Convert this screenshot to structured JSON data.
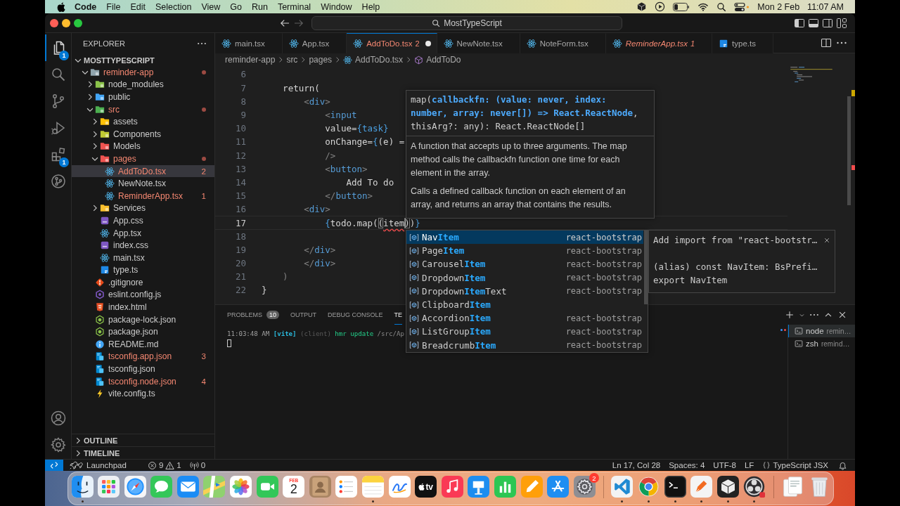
{
  "menu_bar": {
    "app_name": "Code",
    "items": [
      "File",
      "Edit",
      "Selection",
      "View",
      "Go",
      "Run",
      "Terminal",
      "Window",
      "Help"
    ],
    "date": "Mon 2 Feb",
    "time": "11:07 AM"
  },
  "title_bar": {
    "search": "MostTypeScript"
  },
  "activity_bar": {
    "items": [
      {
        "kind": "explorer",
        "selected": true,
        "badge": "1"
      },
      {
        "kind": "search",
        "selected": false
      },
      {
        "kind": "source-control",
        "selected": false
      },
      {
        "kind": "run-debug",
        "selected": false
      },
      {
        "kind": "extensions",
        "selected": false,
        "badge": "1"
      },
      {
        "kind": "remote",
        "selected": false
      }
    ],
    "bottom": [
      {
        "kind": "account"
      },
      {
        "kind": "settings"
      }
    ]
  },
  "sidebar": {
    "title": "EXPLORER",
    "section": "MOSTTYPESCRIPT",
    "tree": [
      {
        "name": "reminder-app",
        "kind": "folder-app",
        "expanded": true,
        "error": true,
        "selected": false,
        "children": [
          {
            "name": "node_modules",
            "kind": "folder-node",
            "expanded": false,
            "error": false,
            "selected": false
          },
          {
            "name": "public",
            "kind": "folder-public",
            "expanded": false,
            "error": false,
            "selected": false
          },
          {
            "name": "src",
            "kind": "folder-src",
            "expanded": true,
            "error": true,
            "selected": false,
            "children": [
              {
                "name": "assets",
                "kind": "folder-assets",
                "expanded": false,
                "error": false,
                "selected": false
              },
              {
                "name": "Components",
                "kind": "folder-components",
                "expanded": false,
                "error": false,
                "selected": false
              },
              {
                "name": "Models",
                "kind": "folder-models",
                "expanded": false,
                "error": false,
                "selected": false
              },
              {
                "name": "pages",
                "kind": "folder-pages",
                "expanded": true,
                "error": true,
                "selected": false,
                "children": [
                  {
                    "name": "AddToDo.tsx",
                    "kind": "react",
                    "error": true,
                    "selected": true,
                    "count": "2"
                  },
                  {
                    "name": "NewNote.tsx",
                    "kind": "react",
                    "error": false,
                    "selected": false
                  },
                  {
                    "name": "ReminderApp.tsx",
                    "kind": "react",
                    "error": true,
                    "selected": false,
                    "count": "1"
                  }
                ]
              },
              {
                "name": "Services",
                "kind": "folder-services",
                "expanded": false,
                "error": false,
                "selected": false
              },
              {
                "name": "App.css",
                "kind": "css",
                "error": false,
                "selected": false
              },
              {
                "name": "App.tsx",
                "kind": "react",
                "error": false,
                "selected": false
              },
              {
                "name": "index.css",
                "kind": "css",
                "error": false,
                "selected": false
              },
              {
                "name": "main.tsx",
                "kind": "react",
                "error": false,
                "selected": false
              },
              {
                "name": "type.ts",
                "kind": "ts",
                "error": false,
                "selected": false
              }
            ]
          },
          {
            "name": ".gitignore",
            "kind": "git",
            "error": false,
            "selected": false
          },
          {
            "name": "eslint.config.js",
            "kind": "eslint",
            "error": false,
            "selected": false
          },
          {
            "name": "index.html",
            "kind": "html",
            "error": false,
            "selected": false
          },
          {
            "name": "package-lock.json",
            "kind": "node-json",
            "error": false,
            "selected": false
          },
          {
            "name": "package.json",
            "kind": "node-json",
            "error": false,
            "selected": false
          },
          {
            "name": "README.md",
            "kind": "info",
            "error": false,
            "selected": false
          },
          {
            "name": "tsconfig.app.json",
            "kind": "tsconfig",
            "error": true,
            "selected": false,
            "count": "3"
          },
          {
            "name": "tsconfig.json",
            "kind": "tsconfig",
            "error": false,
            "selected": false
          },
          {
            "name": "tsconfig.node.json",
            "kind": "tsconfig",
            "error": true,
            "selected": false,
            "count": "4"
          },
          {
            "name": "vite.config.ts",
            "kind": "vite",
            "error": false,
            "selected": false
          }
        ]
      }
    ],
    "collapsed_sections": [
      "OUTLINE",
      "TIMELINE"
    ]
  },
  "tabs": [
    {
      "label": "main.tsx",
      "kind": "react",
      "selected": false,
      "error": false,
      "preview": false,
      "dirty": false
    },
    {
      "label": "App.tsx",
      "kind": "react",
      "selected": false,
      "error": false,
      "preview": false,
      "dirty": false
    },
    {
      "label": "AddToDo.tsx",
      "kind": "react",
      "selected": true,
      "error": true,
      "preview": false,
      "dirty": true,
      "count": "2"
    },
    {
      "label": "NewNote.tsx",
      "kind": "react",
      "selected": false,
      "error": false,
      "preview": false,
      "dirty": false
    },
    {
      "label": "NoteForm.tsx",
      "kind": "react",
      "selected": false,
      "error": false,
      "preview": false,
      "dirty": false
    },
    {
      "label": "ReminderApp.tsx",
      "kind": "react",
      "selected": false,
      "error": true,
      "preview": true,
      "dirty": false,
      "count": "1"
    },
    {
      "label": "type.ts",
      "kind": "ts",
      "selected": false,
      "error": false,
      "preview": false,
      "dirty": false
    }
  ],
  "breadcrumb": [
    {
      "label": "reminder-app",
      "kind": "folder"
    },
    {
      "label": "src",
      "kind": "folder"
    },
    {
      "label": "pages",
      "kind": "folder"
    },
    {
      "label": "AddToDo.tsx",
      "kind": "react"
    },
    {
      "label": "AddToDo",
      "kind": "component"
    }
  ],
  "editor": {
    "lines": [
      {
        "number": "6",
        "current": false
      },
      {
        "number": "7",
        "current": false,
        "tokens": [
          {
            "text": "    return(",
            "kind": "plain"
          }
        ]
      },
      {
        "number": "8",
        "current": false,
        "tokens": [
          {
            "text": "        <",
            "kind": "punct"
          },
          {
            "text": "div",
            "kind": "tag"
          },
          {
            "text": ">",
            "kind": "punct"
          }
        ]
      },
      {
        "number": "9",
        "current": false,
        "tokens": [
          {
            "text": "            <",
            "kind": "punct"
          },
          {
            "text": "input",
            "kind": "tag"
          }
        ]
      },
      {
        "number": "10",
        "current": false,
        "tokens": [
          {
            "text": "            value=",
            "kind": "plain"
          },
          {
            "text": "{task}",
            "kind": "expr"
          }
        ]
      },
      {
        "number": "11",
        "current": false,
        "tokens": [
          {
            "text": "            onChange=",
            "kind": "plain"
          },
          {
            "text": "{",
            "kind": "expr"
          },
          {
            "text": "(e) =",
            "kind": "plain"
          }
        ]
      },
      {
        "number": "12",
        "current": false,
        "tokens": [
          {
            "text": "            />",
            "kind": "punct"
          }
        ]
      },
      {
        "number": "13",
        "current": false,
        "tokens": [
          {
            "text": "            <",
            "kind": "punct"
          },
          {
            "text": "button",
            "kind": "tag"
          },
          {
            "text": ">",
            "kind": "punct"
          }
        ]
      },
      {
        "number": "14",
        "current": false,
        "tokens": [
          {
            "text": "                Add To do",
            "kind": "plain"
          }
        ]
      },
      {
        "number": "15",
        "current": false,
        "tokens": [
          {
            "text": "            </",
            "kind": "punct"
          },
          {
            "text": "button",
            "kind": "tag"
          },
          {
            "text": ">",
            "kind": "punct"
          }
        ]
      },
      {
        "number": "16",
        "current": false,
        "tokens": [
          {
            "text": "        <",
            "kind": "punct"
          },
          {
            "text": "div",
            "kind": "tag"
          },
          {
            "text": ">",
            "kind": "punct"
          }
        ]
      },
      {
        "number": "17",
        "current": true,
        "tokens": [
          {
            "text": "            {",
            "kind": "expr"
          },
          {
            "text": "todo.map(",
            "kind": "plain"
          },
          {
            "text": "(",
            "kind": "bracket"
          },
          {
            "text": "item",
            "kind": "error"
          },
          {
            "text": ")",
            "kind": "bracket-caret"
          },
          {
            "text": ")",
            "kind": "plain"
          },
          {
            "text": "}",
            "kind": "expr"
          }
        ]
      },
      {
        "number": "18",
        "current": false
      },
      {
        "number": "19",
        "current": false,
        "tokens": [
          {
            "text": "        </",
            "kind": "punct"
          },
          {
            "text": "div",
            "kind": "tag"
          },
          {
            "text": ">",
            "kind": "punct"
          }
        ]
      },
      {
        "number": "20",
        "current": false,
        "tokens": [
          {
            "text": "        </",
            "kind": "punct"
          },
          {
            "text": "div",
            "kind": "tag"
          },
          {
            "text": ">",
            "kind": "punct"
          }
        ]
      },
      {
        "number": "21",
        "current": false,
        "tokens": [
          {
            "text": "    )",
            "kind": "punct"
          }
        ]
      },
      {
        "number": "22",
        "current": false,
        "tokens": [
          {
            "text": "}",
            "kind": "plain"
          }
        ]
      }
    ]
  },
  "hover": {
    "signature": {
      "before": "map(",
      "active": "callbackfn: (value: never, index: number, array: never[]) => React.ReactNode",
      "after": ", thisArg?: any): React.ReactNode[]"
    },
    "documentation": [
      "A function that accepts up to three arguments. The map method calls the callbackfn function one time for each element in the array.",
      "Calls a defined callback function on each element of an array, and returns an array that contains the results."
    ]
  },
  "suggestions": [
    {
      "label": "Nav**Item**",
      "source": "react-bootstrap",
      "selected": true
    },
    {
      "label": "Page**Item**",
      "source": "react-bootstrap",
      "selected": false
    },
    {
      "label": "Carousel**Item**",
      "source": "react-bootstrap",
      "selected": false
    },
    {
      "label": "Dropdown**Item**",
      "source": "react-bootstrap",
      "selected": false
    },
    {
      "label": "Dropdown**Item**Text",
      "source": "react-bootstrap",
      "selected": false
    },
    {
      "label": "Clipboard**Item**",
      "selected": false
    },
    {
      "label": "Accordion**Item**",
      "source": "react-bootstrap",
      "selected": false
    },
    {
      "label": "ListGroup**Item**",
      "source": "react-bootstrap",
      "selected": false
    },
    {
      "label": "Breadcrumb**Item**",
      "source": "react-bootstrap",
      "selected": false
    }
  ],
  "suggestion_details": {
    "title": "Add import from \"react-bootstr…",
    "lines": [
      "(alias) const NavItem: BsPrefi…",
      "export NavItem"
    ]
  },
  "panel": {
    "tabs": [
      {
        "label": "PROBLEMS",
        "badge": "10",
        "selected": false
      },
      {
        "label": "OUTPUT",
        "selected": false
      },
      {
        "label": "DEBUG CONSOLE",
        "selected": false
      },
      {
        "label": "TE",
        "selected": true
      }
    ],
    "terminal_line": [
      {
        "text": "11:03:48 AM",
        "kind": "time"
      },
      {
        "text": "[vite]",
        "kind": "tag"
      },
      {
        "text": "(client)",
        "kind": "dim"
      },
      {
        "text": "hmr update",
        "kind": "success"
      },
      {
        "text": "/src/Ap",
        "kind": "path"
      }
    ],
    "terminals": [
      {
        "name": "node",
        "detail": "remin…",
        "selected": true
      },
      {
        "name": "zsh",
        "detail": "remind…",
        "selected": false
      }
    ]
  },
  "status_bar": {
    "left": [
      {
        "kind": "remote"
      },
      {
        "kind": "launchpad",
        "label": "Launchpad"
      },
      {
        "kind": "problems",
        "errors": "9",
        "warnings": "1"
      },
      {
        "kind": "ports",
        "label": "0"
      }
    ],
    "right": [
      {
        "kind": "text",
        "label": "Ln 17, Col 28"
      },
      {
        "kind": "text",
        "label": "Spaces: 4"
      },
      {
        "kind": "text",
        "label": "UTF-8"
      },
      {
        "kind": "text",
        "label": "LF"
      },
      {
        "kind": "language",
        "label": "TypeScript JSX"
      },
      {
        "kind": "notifications"
      }
    ]
  },
  "dock": {
    "sections": [
      {
        "items": [
          {
            "kind": "finder",
            "running": true
          },
          {
            "kind": "launchpad",
            "running": false
          },
          {
            "kind": "safari",
            "running": false
          },
          {
            "kind": "messages",
            "running": false
          },
          {
            "kind": "mail",
            "running": false
          },
          {
            "kind": "maps",
            "running": false
          },
          {
            "kind": "photos",
            "running": false
          },
          {
            "kind": "facetime",
            "running": false
          },
          {
            "kind": "calendar",
            "month": "FEB",
            "day": "2",
            "running": false
          },
          {
            "kind": "contacts",
            "running": false
          },
          {
            "kind": "reminders",
            "running": false
          },
          {
            "kind": "notes",
            "running": true
          },
          {
            "kind": "freeform",
            "running": false
          },
          {
            "kind": "tv",
            "label": "tv",
            "running": false
          },
          {
            "kind": "music",
            "running": false
          },
          {
            "kind": "keynote",
            "running": false
          },
          {
            "kind": "numbers",
            "running": false
          },
          {
            "kind": "pages",
            "running": false
          },
          {
            "kind": "app-store",
            "running": false
          },
          {
            "kind": "settings",
            "badge": "2",
            "running": false
          }
        ]
      },
      {
        "items": [
          {
            "kind": "vscode",
            "running": true
          },
          {
            "kind": "chrome",
            "running": true
          },
          {
            "kind": "terminal",
            "running": true
          },
          {
            "kind": "pen-app",
            "running": true
          },
          {
            "kind": "cube-app",
            "running": true
          },
          {
            "kind": "obs",
            "running": true
          }
        ]
      },
      {
        "items": [
          {
            "kind": "downloads",
            "running": false
          },
          {
            "kind": "trash",
            "running": false
          }
        ]
      }
    ]
  }
}
